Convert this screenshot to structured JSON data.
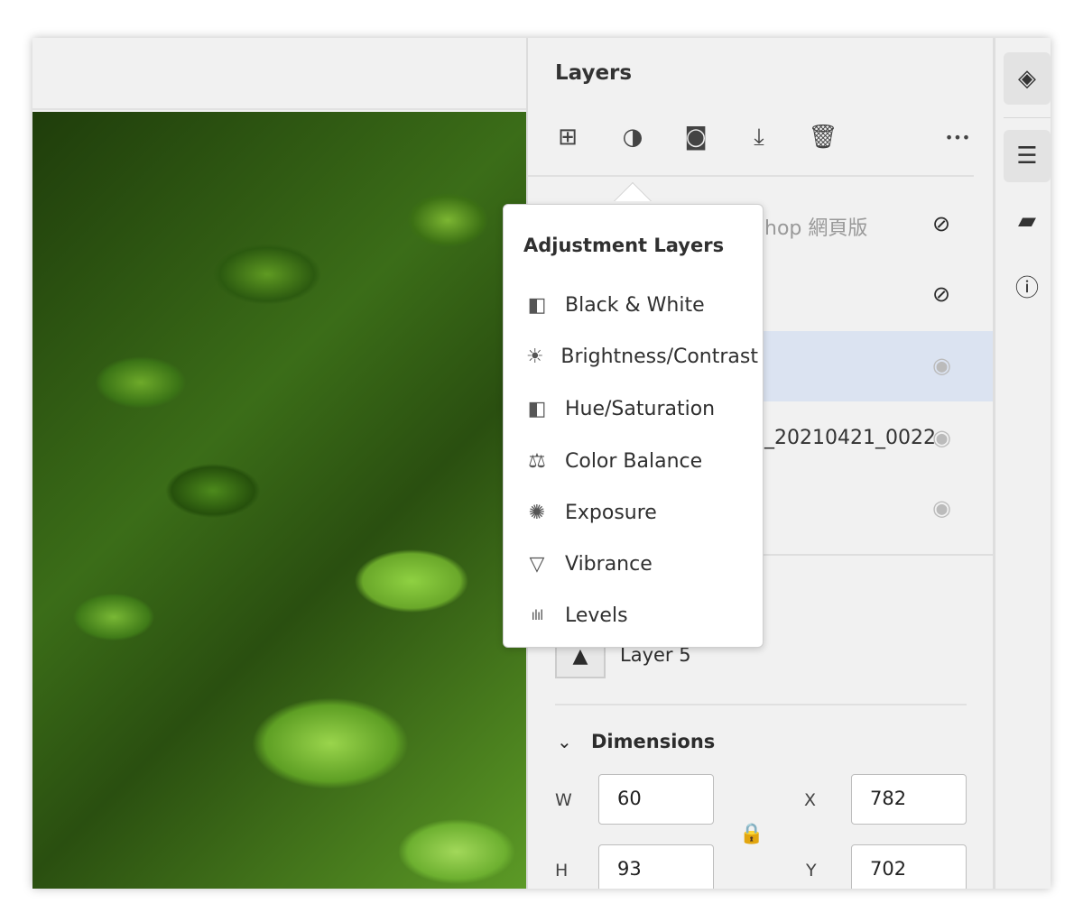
{
  "panel": {
    "title": "Layers",
    "toolbar": [
      {
        "name": "add-layer",
        "glyph": "⊞"
      },
      {
        "name": "adjustment-layer",
        "glyph": "◑"
      },
      {
        "name": "mask",
        "glyph": "◙"
      },
      {
        "name": "clip",
        "glyph": "⤓"
      },
      {
        "name": "delete",
        "glyph": "🗑"
      },
      {
        "name": "more",
        "glyph": "•••"
      }
    ],
    "layers": [
      {
        "name": "hop 網頁版",
        "visible": false
      },
      {
        "name": "",
        "visible": false
      },
      {
        "name": "",
        "visible": true,
        "selected": true
      },
      {
        "name": "_20210421_0022",
        "visible": true
      },
      {
        "name": "",
        "visible": true
      }
    ],
    "current_layer": "Layer 5",
    "dimensions": {
      "title": "Dimensions",
      "w_label": "W",
      "w": "60",
      "h_label": "H",
      "h": "93",
      "x_label": "X",
      "x": "782",
      "y_label": "Y",
      "y": "702"
    }
  },
  "popup": {
    "title": "Adjustment Layers",
    "items": [
      {
        "label": "Black & White",
        "icon": "black-white",
        "glyph": "◧"
      },
      {
        "label": "Brightness/Contrast",
        "icon": "brightness",
        "glyph": "☀"
      },
      {
        "label": "Hue/Saturation",
        "icon": "hue-saturation",
        "glyph": "◧"
      },
      {
        "label": "Color Balance",
        "icon": "scales",
        "glyph": "⚖"
      },
      {
        "label": "Exposure",
        "icon": "aperture",
        "glyph": "✺"
      },
      {
        "label": "Vibrance",
        "icon": "triangle",
        "glyph": "▽"
      },
      {
        "label": "Levels",
        "icon": "histogram",
        "glyph": "ılıl"
      }
    ]
  },
  "sidebar": [
    {
      "name": "layers",
      "glyph": "◈"
    },
    {
      "name": "properties",
      "glyph": "☰"
    },
    {
      "name": "comments",
      "glyph": "▰"
    },
    {
      "name": "info",
      "glyph": "ⓘ"
    }
  ]
}
